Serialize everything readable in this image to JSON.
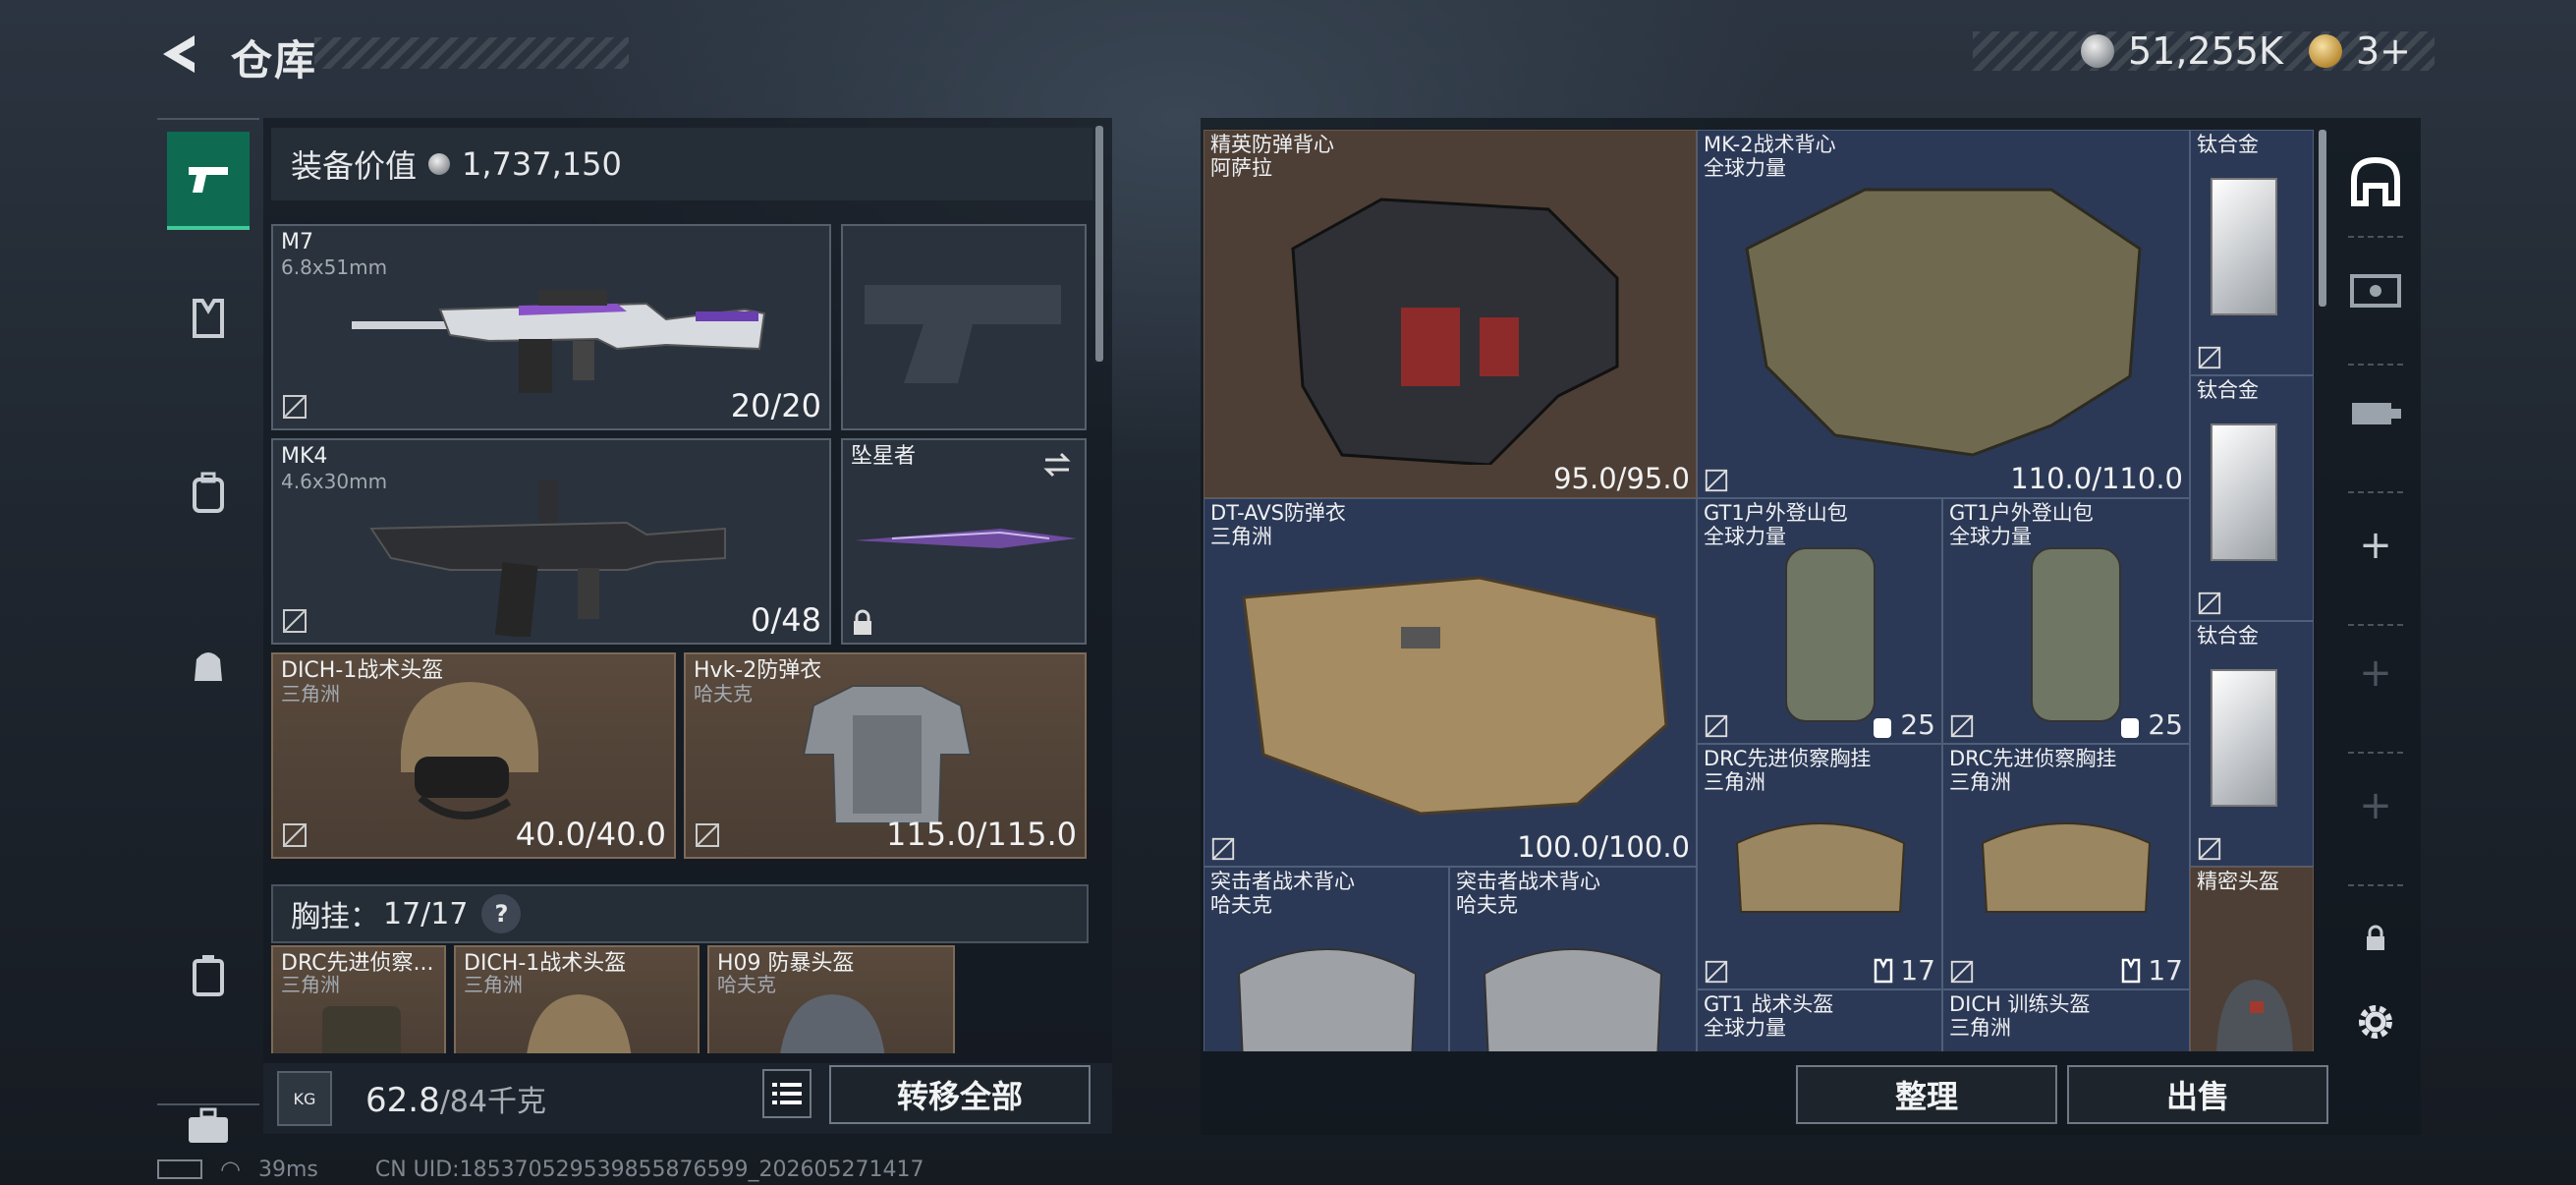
{
  "header": {
    "title": "仓库",
    "currency_silver": "51,255K",
    "currency_gold": "3+"
  },
  "left_nav": [
    "pistol-icon",
    "vest-icon",
    "backpack-icon",
    "pouch-icon",
    "case-icon",
    "toolbox-icon"
  ],
  "loadout": {
    "value_label": "装备价值",
    "value": "1,737,150",
    "slots": [
      {
        "name": "M7",
        "sub": "6.8x51mm",
        "count": "20/20"
      },
      {
        "name": "",
        "sub": "",
        "count": ""
      },
      {
        "name": "MK4",
        "sub": "4.6x30mm",
        "count": "0/48"
      },
      {
        "name": "坠星者",
        "sub": "",
        "count": ""
      },
      {
        "name": "DICH-1战术头盔",
        "sub": "三角洲",
        "count": "40.0/40.0"
      },
      {
        "name": "Hvk-2防弹衣",
        "sub": "哈夫克",
        "count": "115.0/115.0"
      }
    ],
    "chest_label": "胸挂：",
    "chest_value": "17/17",
    "chest_help": "?",
    "chest_items": [
      {
        "name": "DRC先进侦察...",
        "sub": "三角洲"
      },
      {
        "name": "DICH-1战术头盔",
        "sub": "三角洲"
      },
      {
        "name": "H09 防暴头盔",
        "sub": "哈夫克"
      }
    ],
    "weight_current": "62.8",
    "weight_max": "/84千克",
    "kg_label": "KG",
    "transfer_all": "转移全部"
  },
  "storage": {
    "items": [
      {
        "name": "精英防弹背心",
        "sub": "阿萨拉",
        "count": "95.0/95.0"
      },
      {
        "name": "MK-2战术背心",
        "sub": "全球力量",
        "count": "110.0/110.0"
      },
      {
        "name": "钛合金",
        "sub": "",
        "count": ""
      },
      {
        "name": "钛合金",
        "sub": "",
        "count": ""
      },
      {
        "name": "DT-AVS防弹衣",
        "sub": "三角洲",
        "count": "100.0/100.0"
      },
      {
        "name": "GT1户外登山包",
        "sub": "全球力量",
        "count": "25"
      },
      {
        "name": "GT1户外登山包",
        "sub": "全球力量",
        "count": "25"
      },
      {
        "name": "钛合金",
        "sub": "",
        "count": ""
      },
      {
        "name": "DRC先进侦察胸挂",
        "sub": "三角洲",
        "count": "17"
      },
      {
        "name": "DRC先进侦察胸挂",
        "sub": "三角洲",
        "count": "17"
      },
      {
        "name": "突击者战术背心",
        "sub": "哈夫克",
        "count": ""
      },
      {
        "name": "突击者战术背心",
        "sub": "哈夫克",
        "count": ""
      },
      {
        "name": "精密头盔",
        "sub": "",
        "count": ""
      },
      {
        "name": "GT1 战术头盔",
        "sub": "全球力量",
        "count": ""
      },
      {
        "name": "DICH 训练头盔",
        "sub": "三角洲",
        "count": ""
      }
    ],
    "sort_label": "整理",
    "sell_label": "出售"
  },
  "right_nav": [
    "helmet-tab-icon",
    "ticket-icon",
    "key-icon",
    "plus-icon",
    "plus-icon",
    "plus-icon",
    "lock-icon",
    "settings-icon"
  ],
  "status_bar": {
    "ping": "39ms",
    "uid": "CN UID:185370529539855876599_202605271417"
  }
}
